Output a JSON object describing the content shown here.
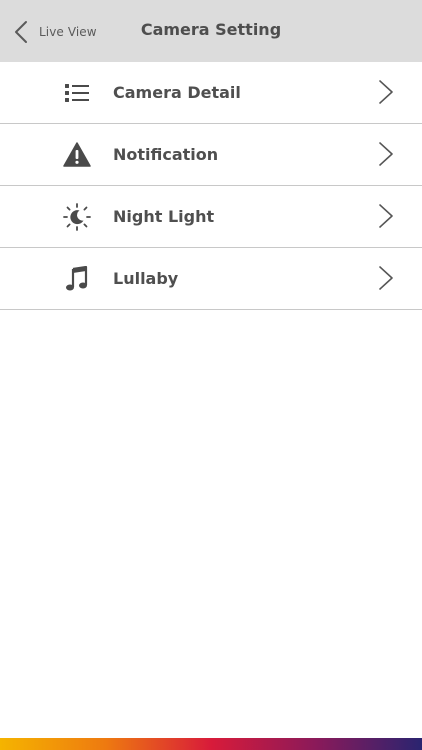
{
  "header": {
    "back_label": "Live View",
    "title": "Camera Setting"
  },
  "menu": {
    "items": [
      {
        "label": "Camera Detail",
        "icon": "list-icon"
      },
      {
        "label": "Notification",
        "icon": "warning-icon"
      },
      {
        "label": "Night Light",
        "icon": "night-light-icon"
      },
      {
        "label": "Lullaby",
        "icon": "music-note-icon"
      }
    ]
  },
  "colors": {
    "header_bg": "#dcdcdc",
    "text": "#4f4f4f",
    "divider": "#c8c8c8",
    "icon": "#4a4a4a",
    "bottom_gradient": [
      "#f5b400",
      "#ee7a10",
      "#d81b3a",
      "#8a1a5a",
      "#2a2470"
    ]
  }
}
